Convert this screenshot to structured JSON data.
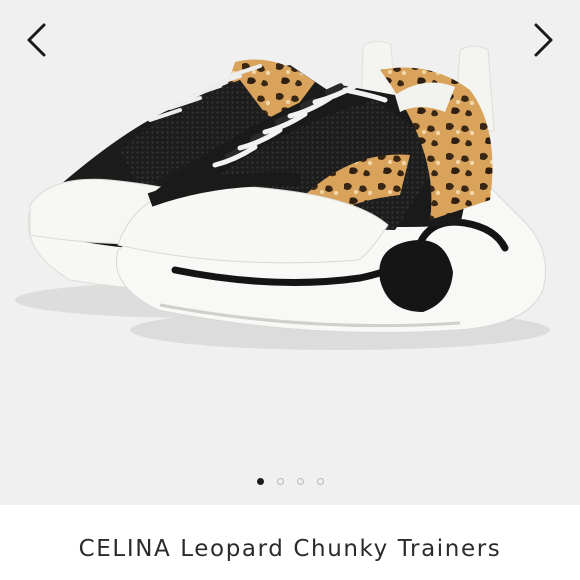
{
  "carousel": {
    "image_alt": "CELINA Leopard Chunky Trainers product photo",
    "prev_icon": "chevron-left-icon",
    "next_icon": "chevron-right-icon",
    "slide_count": 4,
    "active_slide": 1
  },
  "product": {
    "title": "CELINA Leopard Chunky Trainers"
  },
  "colors": {
    "background": "#f0f0f0",
    "dot_active": "#1c1c1c",
    "dot_inactive": "#b9b9b9",
    "title_text": "#2b2b2b"
  }
}
